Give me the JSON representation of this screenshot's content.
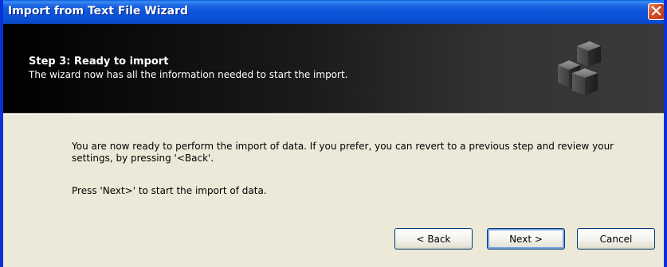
{
  "window": {
    "title": "Import from Text File Wizard",
    "close_icon": "close-icon",
    "accent": "#0a4fd4",
    "close_color": "#d4502a"
  },
  "header": {
    "step_title": "Step 3: Ready to import",
    "step_description": "The wizard now has all the information needed to start the import.",
    "icon": "cubes-icon"
  },
  "content": {
    "paragraph1": "You are now ready to perform the import of data. If you prefer, you can revert to a previous step and review your settings, by pressing '<Back'.",
    "paragraph2": "Press 'Next>' to start the import of data."
  },
  "buttons": {
    "back": "< Back",
    "next": "Next >",
    "cancel": "Cancel"
  }
}
